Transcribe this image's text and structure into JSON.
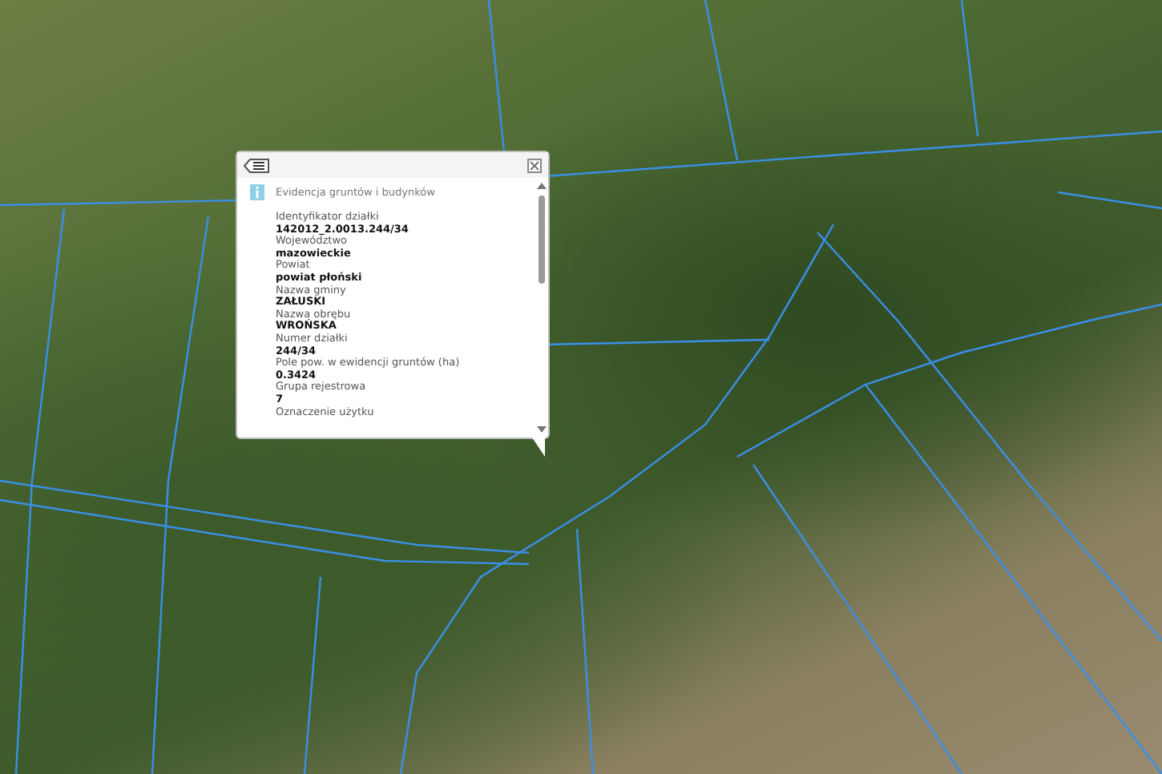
{
  "popup": {
    "title": "Evidencja gruntów i budynków",
    "fields": [
      {
        "label": "Identyfikator działki",
        "value": "142012_2.0013.244/34"
      },
      {
        "label": "Województwo",
        "value": "mazowieckie"
      },
      {
        "label": "Powiat",
        "value": "powiat płoński"
      },
      {
        "label": "Nazwa gminy",
        "value": "ZAŁUSKI"
      },
      {
        "label": "Nazwa obrębu",
        "value": "WROŃSKA"
      },
      {
        "label": "Numer działki",
        "value": "244/34"
      },
      {
        "label": "Pole pow. w ewidencji gruntów (ha)",
        "value": "0.3424"
      },
      {
        "label": "Grupa rejestrowa",
        "value": "7"
      },
      {
        "label": "Oznaczenie użytku"
      }
    ]
  }
}
